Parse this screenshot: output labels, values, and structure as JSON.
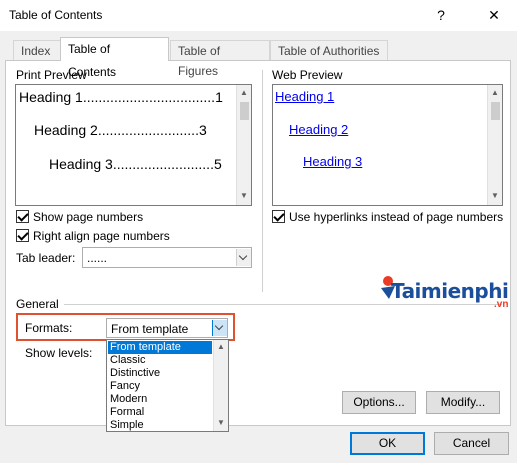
{
  "window": {
    "title": "Table of Contents",
    "help_glyph": "?",
    "close_glyph": "✕"
  },
  "tabs": [
    {
      "label": "Index",
      "active": false
    },
    {
      "label": "Table of Contents",
      "active": true
    },
    {
      "label": "Table of Figures",
      "active": false
    },
    {
      "label": "Table of Authorities",
      "active": false
    }
  ],
  "print_preview": {
    "label": "Print Preview",
    "lines": [
      "Heading 1..................................1",
      "Heading 2..........................3",
      "Heading 3..........................5"
    ]
  },
  "web_preview": {
    "label": "Web Preview",
    "links": [
      "Heading 1",
      "Heading 2",
      "Heading 3"
    ]
  },
  "options": {
    "show_page_numbers": {
      "label": "Show page numbers",
      "checked": true
    },
    "right_align": {
      "label": "Right align page numbers",
      "checked": true
    },
    "hyperlinks": {
      "label": "Use hyperlinks instead of page numbers",
      "checked": true
    },
    "tab_leader": {
      "label": "Tab leader:",
      "value": "......"
    }
  },
  "general": {
    "label": "General",
    "formats": {
      "label": "Formats:",
      "value": "From template",
      "options": [
        "From template",
        "Classic",
        "Distinctive",
        "Fancy",
        "Modern",
        "Formal",
        "Simple"
      ],
      "selected_index": 0
    },
    "show_levels": {
      "label": "Show levels:"
    }
  },
  "buttons": {
    "options": "Options...",
    "modify": "Modify...",
    "ok": "OK",
    "cancel": "Cancel"
  },
  "watermark": {
    "brand": "Taimienphi",
    "suffix": ".vn"
  },
  "colors": {
    "accent": "#0078d7",
    "highlight": "#e0522f",
    "link": "#0000ee"
  }
}
